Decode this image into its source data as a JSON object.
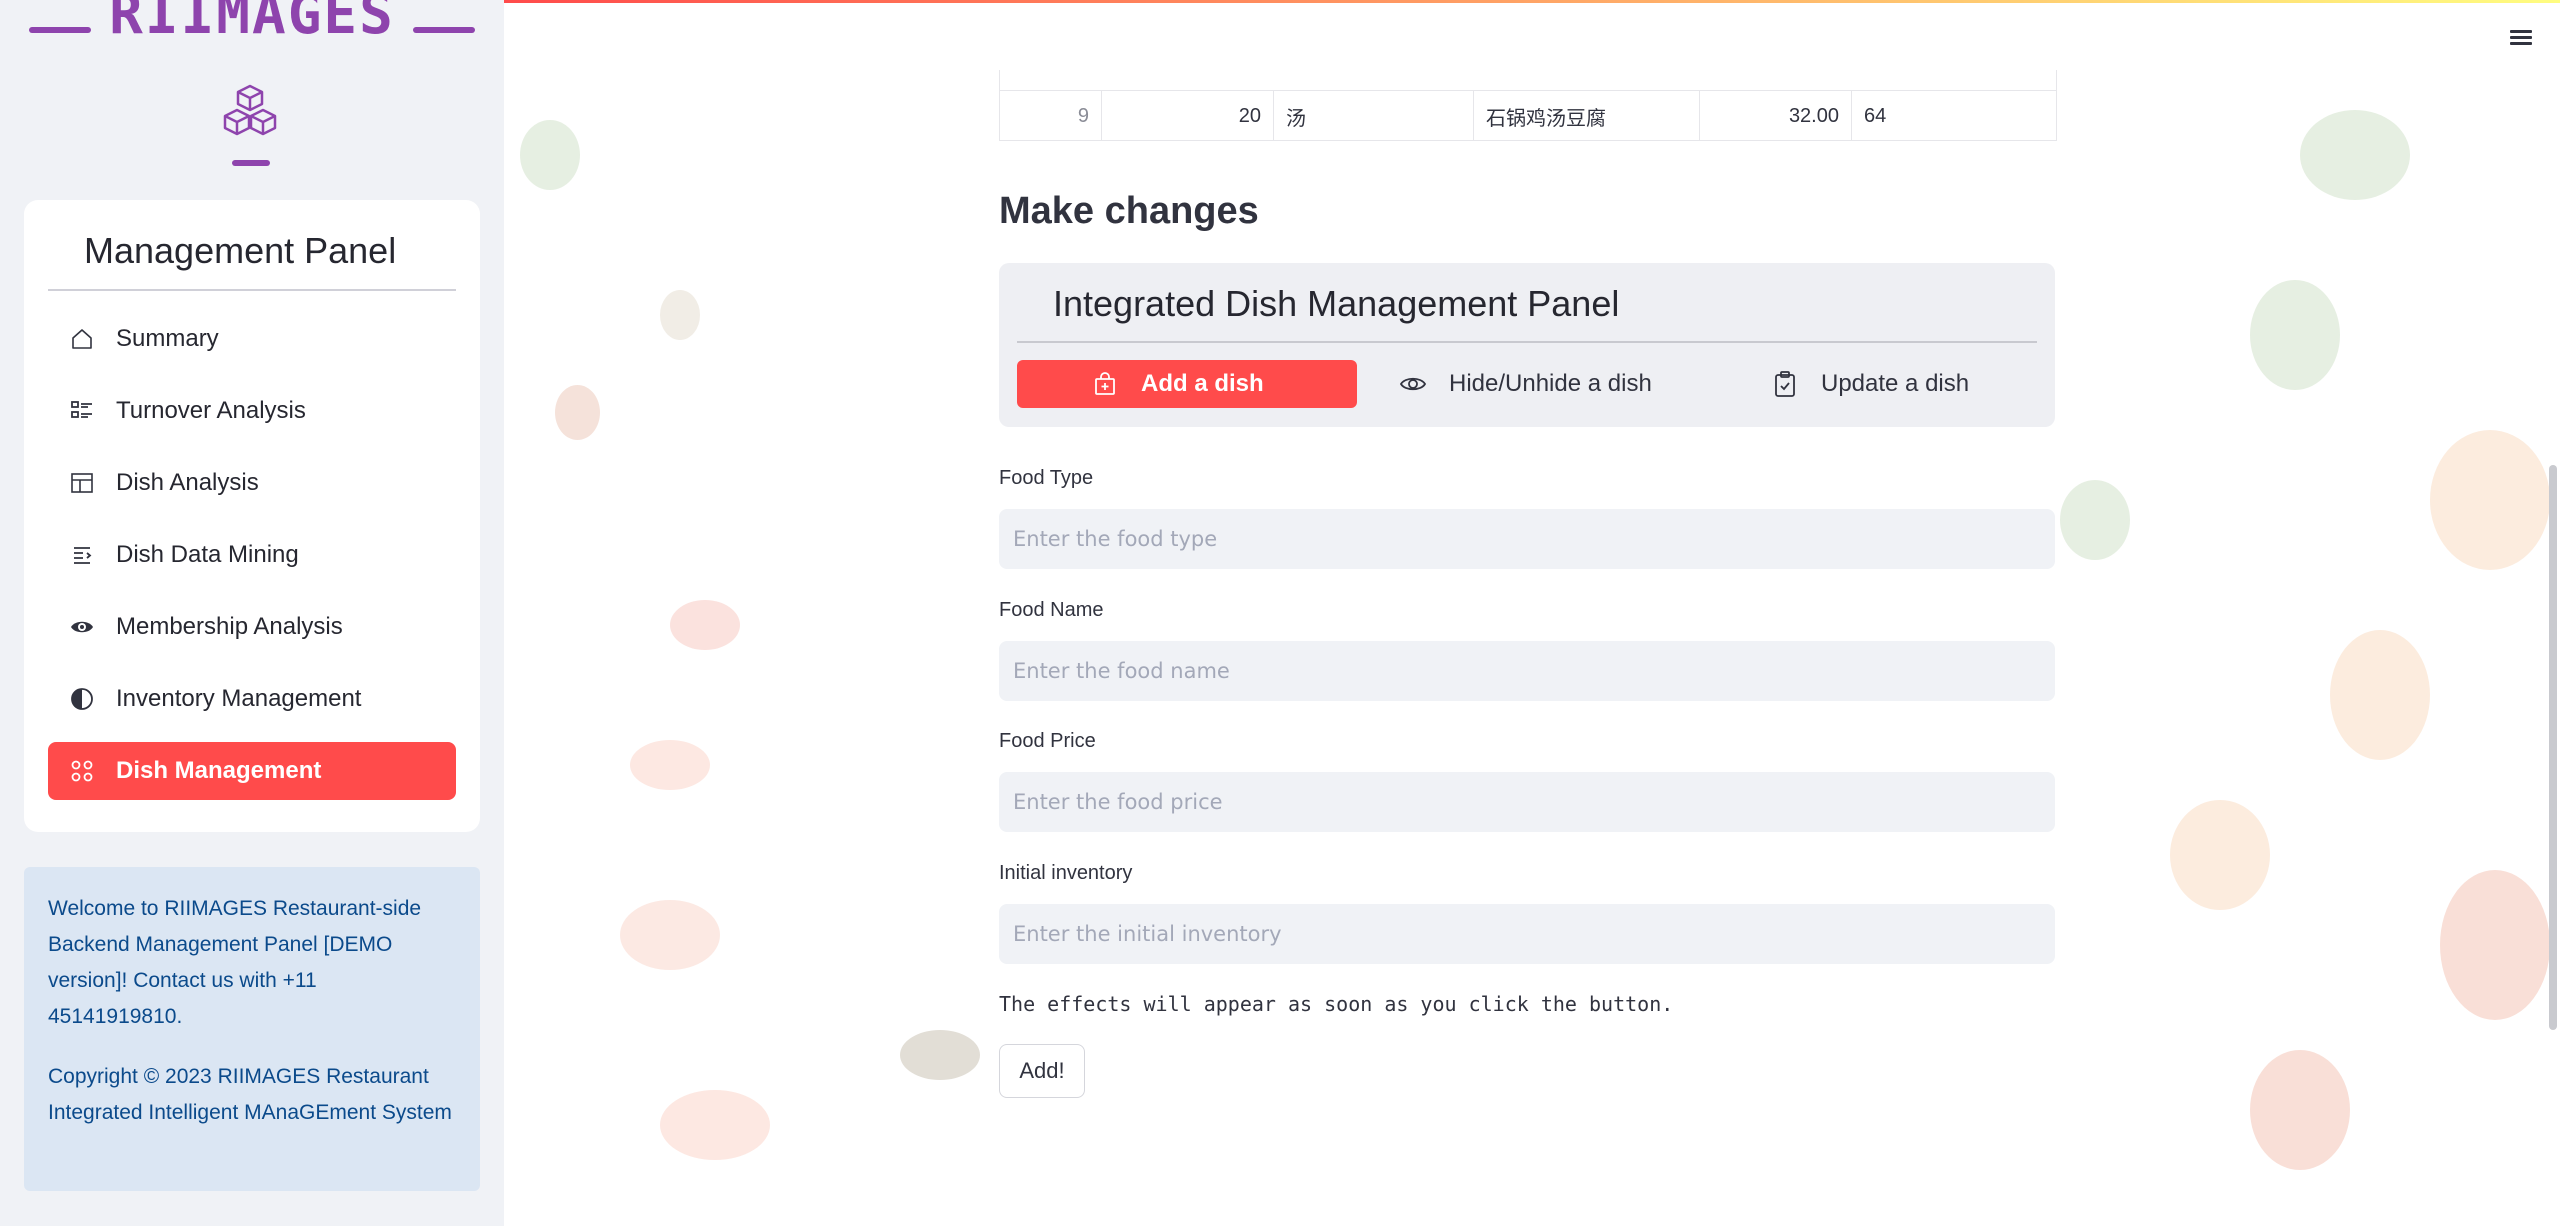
{
  "brand": {
    "name": "RIIMAGES",
    "accent": "#8e44ad"
  },
  "sidebar": {
    "menu_title": "Management Panel",
    "items": [
      {
        "label": "Summary",
        "icon": "house-icon",
        "active": false
      },
      {
        "label": "Turnover Analysis",
        "icon": "list-check-icon",
        "active": false
      },
      {
        "label": "Dish Analysis",
        "icon": "layout-icon",
        "active": false
      },
      {
        "label": "Dish Data Mining",
        "icon": "text-indent-icon",
        "active": false
      },
      {
        "label": "Membership Analysis",
        "icon": "eye-icon",
        "active": false
      },
      {
        "label": "Inventory Management",
        "icon": "half-circle-icon",
        "active": false
      },
      {
        "label": "Dish Management",
        "icon": "grid-circles-icon",
        "active": true
      }
    ],
    "info": {
      "welcome": "Welcome to RIIMAGES Restaurant-side Backend Management Panel [DEMO version]! Contact us with +11 45141919810.",
      "copyright": "Copyright © 2023 RIIMAGES Restaurant Integrated Intelligent MAnaGEment System"
    }
  },
  "table": {
    "row": {
      "index": "9",
      "col1": "20",
      "col2": "汤",
      "col3": "石锅鸡汤豆腐",
      "col4": "32.00",
      "col5": "64"
    }
  },
  "main": {
    "heading": "Make changes",
    "panel_title": "Integrated Dish Management Panel",
    "tabs": [
      {
        "label": "Add a dish",
        "icon": "bag-plus-icon",
        "active": true
      },
      {
        "label": "Hide/Unhide a dish",
        "icon": "eye-icon",
        "active": false
      },
      {
        "label": "Update a dish",
        "icon": "clipboard-check-icon",
        "active": false
      }
    ],
    "fields": [
      {
        "label": "Food Type",
        "placeholder": "Enter the food type",
        "value": ""
      },
      {
        "label": "Food Name",
        "placeholder": "Enter the food name",
        "value": ""
      },
      {
        "label": "Food Price",
        "placeholder": "Enter the food price",
        "value": ""
      },
      {
        "label": "Initial inventory",
        "placeholder": "Enter the initial inventory",
        "value": ""
      }
    ],
    "note": "The effects will appear as soon as you click the button.",
    "submit_label": "Add!"
  },
  "colors": {
    "primary": "#ff4b4b",
    "info_bg": "#dbe6f3",
    "info_text": "#0b4a8b"
  }
}
